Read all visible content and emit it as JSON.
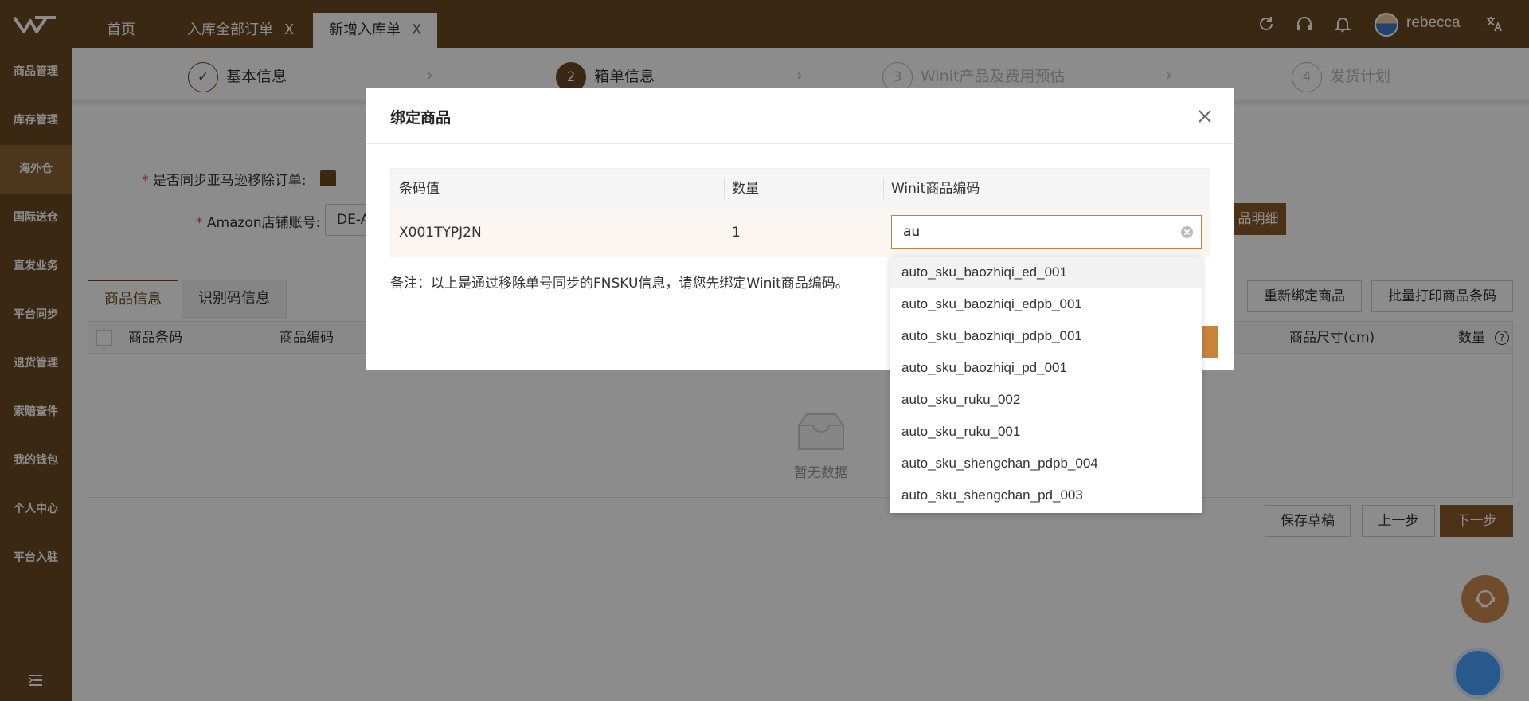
{
  "topbar": {
    "tabs": [
      {
        "label": "首页"
      },
      {
        "label": "入库全部订单",
        "close": "X"
      },
      {
        "label": "新增入库单",
        "close": "X"
      }
    ],
    "username": "rebecca"
  },
  "sidebar": {
    "items": [
      {
        "label": "商品管理"
      },
      {
        "label": "库存管理"
      },
      {
        "label": "海外仓"
      },
      {
        "label": "国际送仓"
      },
      {
        "label": "直发业务"
      },
      {
        "label": "平台同步"
      },
      {
        "label": "退货管理"
      },
      {
        "label": "索赔查件"
      },
      {
        "label": "我的钱包"
      },
      {
        "label": "个人中心"
      },
      {
        "label": "平台入驻"
      }
    ]
  },
  "steps": [
    {
      "num": "",
      "label": "基本信息"
    },
    {
      "num": "2",
      "label": "箱单信息"
    },
    {
      "num": "3",
      "label": "Winit产品及费用预估"
    },
    {
      "num": "4",
      "label": "发货计划"
    }
  ],
  "form": {
    "sync_label": "是否同步亚马逊移除订单:",
    "store_label": "Amazon店铺账号:",
    "store_value": "DE-A",
    "detail_button": "品明细"
  },
  "subtabs": [
    "商品信息",
    "识别码信息"
  ],
  "actions": {
    "rebind": "重新绑定商品",
    "batch_print": "批量打印商品条码",
    "save_draft": "保存草稿",
    "prev": "上一步",
    "next": "下一步"
  },
  "grid": {
    "columns": [
      "商品条码",
      "商品编码",
      "商品尺寸(cm)",
      "数量"
    ],
    "empty": "暂无数据"
  },
  "modal": {
    "title": "绑定商品",
    "columns": [
      "条码值",
      "数量",
      "Winit商品编码"
    ],
    "row": {
      "barcode": "X001TYPJ2N",
      "qty": "1",
      "sku_value": "au"
    },
    "note": "备注：以上是通过移除单号同步的FNSKU信息，请您先绑定Winit商品编码。"
  },
  "dropdown": {
    "options": [
      "auto_sku_baozhiqi_ed_001",
      "auto_sku_baozhiqi_edpb_001",
      "auto_sku_baozhiqi_pdpb_001",
      "auto_sku_baozhiqi_pd_001",
      "auto_sku_ruku_002",
      "auto_sku_ruku_001",
      "auto_sku_shengchan_pdpb_004",
      "auto_sku_shengchan_pd_003"
    ]
  },
  "colors": {
    "brand": "#6b4a22",
    "accent": "#8a5a28",
    "focus": "#c8823a"
  }
}
